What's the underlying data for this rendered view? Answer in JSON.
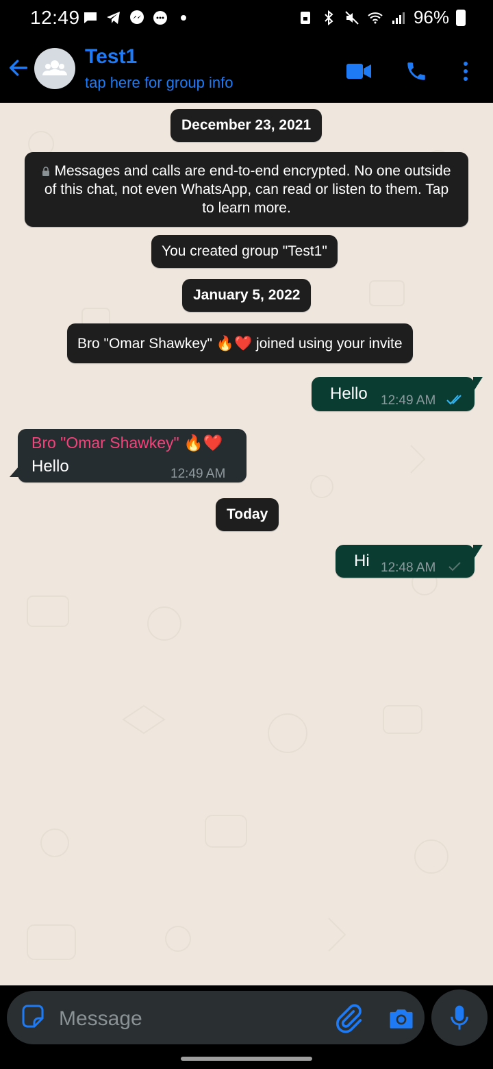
{
  "status_bar": {
    "time": "12:49",
    "battery": "96%",
    "left_icons": [
      "message-icon",
      "telegram-icon",
      "messenger-icon",
      "chat-bubble-icon",
      "dot-icon"
    ],
    "right_icons": [
      "lock-screen-icon",
      "bluetooth-icon",
      "mute-icon",
      "wifi-icon",
      "signal-icon",
      "battery-icon"
    ]
  },
  "header": {
    "title": "Test1",
    "subtitle": "tap here for group info",
    "accent_color": "#1f7bf5"
  },
  "chat": {
    "date_1": "December 23, 2021",
    "encryption_notice": "Messages and calls are end-to-end encrypted. No one outside of this chat, not even WhatsApp, can read or listen to them. Tap to learn more.",
    "created_notice": "You created group \"Test1\"",
    "date_2": "January 5, 2022",
    "joined_name": "Bro \"Omar Shawkey\" ",
    "joined_emoji": "🔥❤️",
    "joined_suffix": " joined using your invite",
    "messages": [
      {
        "direction": "out",
        "text": "Hello",
        "time": "12:49 AM",
        "status": "read"
      },
      {
        "direction": "in",
        "sender": "Bro \"Omar Shawkey\" ",
        "sender_emoji": "🔥❤️",
        "text": "Hello",
        "time": "12:49 AM"
      }
    ],
    "date_3": "Today",
    "messages_today": [
      {
        "direction": "out",
        "text": "Hi",
        "time": "12:48 AM",
        "status": "sent"
      }
    ]
  },
  "input": {
    "placeholder": "Message"
  },
  "colors": {
    "outgoing_bubble": "#0a3c32",
    "incoming_bubble": "#262d31",
    "sender_name": "#f4437a",
    "read_ticks": "#34b7f1",
    "chat_background": "#efe7de"
  }
}
